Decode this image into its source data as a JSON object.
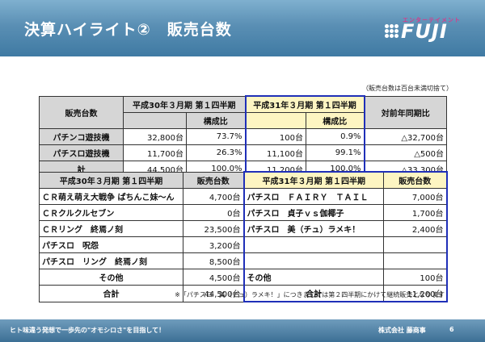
{
  "header": {
    "title": "決算ハイライト②　販売台数"
  },
  "logo": {
    "tag": "エンターテイメント",
    "word": "FUJI"
  },
  "note": "（販売台数は百台未満切捨て）",
  "summary": {
    "col_label": "販売台数",
    "prev_period": "平成30年３月期 第１四半期",
    "cur_period": "平成31年３月期 第１四半期",
    "ratio_label": "構成比",
    "yoy_label": "対前年同期比",
    "rows": [
      {
        "label": "パチンコ遊技機",
        "prev_units": "32,800台",
        "prev_ratio": "73.7%",
        "cur_units": "100台",
        "cur_ratio": "0.9%",
        "yoy": "△32,700台"
      },
      {
        "label": "パチスロ遊技機",
        "prev_units": "11,700台",
        "prev_ratio": "26.3%",
        "cur_units": "11,100台",
        "cur_ratio": "99.1%",
        "yoy": "△500台"
      },
      {
        "label": "計",
        "prev_units": "44,500台",
        "prev_ratio": "100.0%",
        "cur_units": "11,200台",
        "cur_ratio": "100.0%",
        "yoy": "△33,300台"
      }
    ]
  },
  "detail": {
    "prev_period": "平成30年３月期 第１四半期",
    "cur_period": "平成31年３月期 第１四半期",
    "units_label": "販売台数",
    "rows": [
      {
        "prev_name": "ＣＲ萌え萌え大戦争 ぱちんこ妹～ん",
        "prev_units": "4,700台",
        "cur_name": "パチスロ　ＦＡＩＲＹ　ＴＡＩＬ",
        "cur_units": "7,000台"
      },
      {
        "prev_name": "ＣＲクルクルセブン",
        "prev_units": "0台",
        "cur_name": "パチスロ　貞子ｖｓ伽椰子",
        "cur_units": "1,700台"
      },
      {
        "prev_name": "ＣＲリング　終焉ノ刻",
        "prev_units": "23,500台",
        "cur_name": "パチスロ　美（チュ）ラメキ！",
        "cur_units": "2,400台"
      },
      {
        "prev_name": "パチスロ　呪怨",
        "prev_units": "3,200台",
        "cur_name": "",
        "cur_units": ""
      },
      {
        "prev_name": "パチスロ　リング　終焉ノ刻",
        "prev_units": "8,500台",
        "cur_name": "",
        "cur_units": ""
      }
    ],
    "other": {
      "label": "その他",
      "prev_units": "4,500台",
      "cur_units": "100台"
    },
    "total": {
      "label": "合計",
      "prev_units": "44,500台",
      "cur_units": "11,200台"
    }
  },
  "foot_note": "※「パチスロ　美（チュ）ラメキ！」につきましては第２四半期にかけて継続販売となります",
  "footer": {
    "slogan": "ヒト味違う発想で一歩先の\"オモシロさ\"を目指して！",
    "company": "株式会社 藤商事",
    "page": "6"
  }
}
